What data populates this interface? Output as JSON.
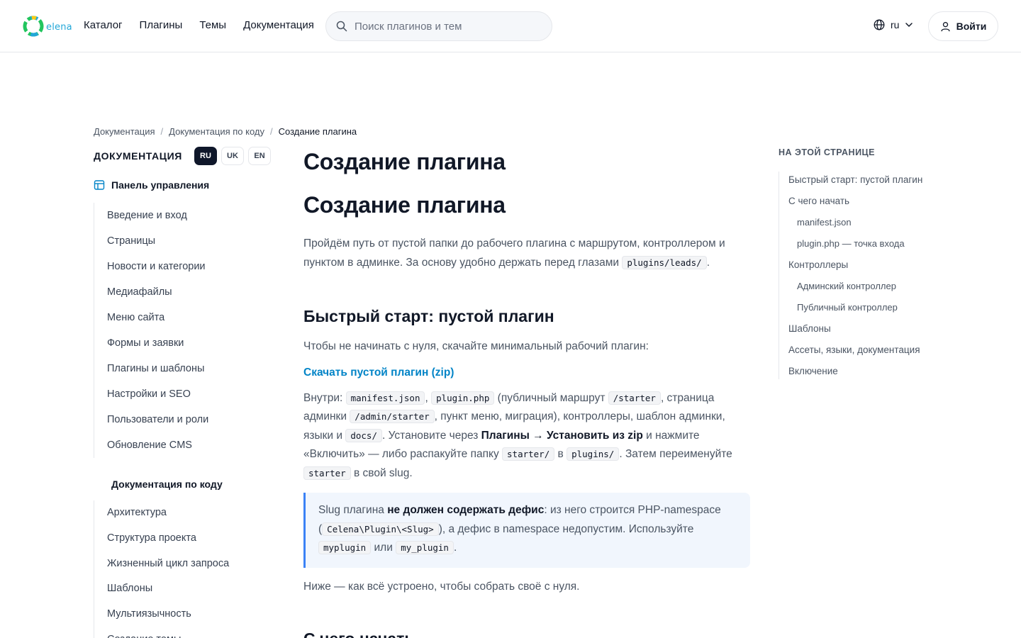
{
  "header": {
    "logo_text": "elena",
    "nav": [
      "Каталог",
      "Плагины",
      "Темы",
      "Документация"
    ],
    "search_placeholder": "Поиск плагинов и тем",
    "language": "ru",
    "login_label": "Войти"
  },
  "breadcrumb": [
    "Документация",
    "Документация по коду",
    "Создание плагина"
  ],
  "sidebar": {
    "title": "ДОКУМЕНТАЦИЯ",
    "langs": [
      {
        "label": "RU",
        "active": true
      },
      {
        "label": "UK",
        "active": false
      },
      {
        "label": "EN",
        "active": false
      }
    ],
    "section1": "Панель управления",
    "items1": [
      "Введение и вход",
      "Страницы",
      "Новости и категории",
      "Медиафайлы",
      "Меню сайта",
      "Формы и заявки",
      "Плагины и шаблоны",
      "Настройки и SEO",
      "Пользователи и роли",
      "Обновление CMS"
    ],
    "section2": "Документация по коду",
    "items2": [
      "Архитектура",
      "Структура проекта",
      "Жизненный цикл запроса",
      "Шаблоны",
      "Мультиязычность",
      "Создание темы"
    ]
  },
  "article": {
    "title1": "Создание плагина",
    "title2": "Создание плагина",
    "lead_text": "Пройдём путь от пустой папки до рабочего плагина с маршрутом, контроллером и пунктом в админке. За основу удобно держать перед глазами",
    "lead_code": "plugins/leads/",
    "lead_end": ".",
    "h2_quick": "Быстрый старт: пустой плагин",
    "quick_intro": "Чтобы не начинать с нуля, скачайте минимальный рабочий плагин:",
    "download_link": "Скачать пустой плагин (zip)",
    "inside": {
      "t1": "Внутри: ",
      "c1": "manifest.json",
      "t2": ", ",
      "c2": "plugin.php",
      "t3": " (публичный маршрут ",
      "c3": "/starter",
      "t4": ", страница админки ",
      "c4": "/admin/starter",
      "t5": ", пункт меню, миграция), контроллеры, шаблон админки, языки и ",
      "c5": "docs/",
      "t6": ". Установите через ",
      "b1": "Плагины → Установить из zip",
      "t7": " и нажмите «Включить» — либо распакуйте папку ",
      "c6": "starter/",
      "t8": " в ",
      "c7": "plugins/",
      "t9": ". Затем переименуйте ",
      "c8": "starter",
      "t10": " в свой slug."
    },
    "callout": {
      "t1": "Slug плагина ",
      "b1": "не должен содержать дефис",
      "t2": ": из него строится PHP-namespace (",
      "c1": "Celena\\Plugin\\<Slug>",
      "t3": "), а дефис в namespace недопустим. Используйте ",
      "c2": "myplugin",
      "t4": " или ",
      "c3": "my_plugin",
      "t5": "."
    },
    "below": "Ниже — как всё устроено, чтобы собрать своё с нуля.",
    "h2_next": "С чего начать"
  },
  "toc": {
    "title": "НА ЭТОЙ СТРАНИЦЕ",
    "items": [
      {
        "label": "Быстрый старт: пустой плагин",
        "sub": false
      },
      {
        "label": "С чего начать",
        "sub": false
      },
      {
        "label": "manifest.json",
        "sub": true
      },
      {
        "label": "plugin.php — точка входа",
        "sub": true
      },
      {
        "label": "Контроллеры",
        "sub": false
      },
      {
        "label": "Админский контроллер",
        "sub": true
      },
      {
        "label": "Публичный контроллер",
        "sub": true
      },
      {
        "label": "Шаблоны",
        "sub": false
      },
      {
        "label": "Ассеты, языки, документация",
        "sub": false
      },
      {
        "label": "Включение",
        "sub": false
      }
    ]
  },
  "colors": {
    "accent": "#0284c7",
    "callout_border": "#3b82f6",
    "active_pill": "#0f172a"
  }
}
